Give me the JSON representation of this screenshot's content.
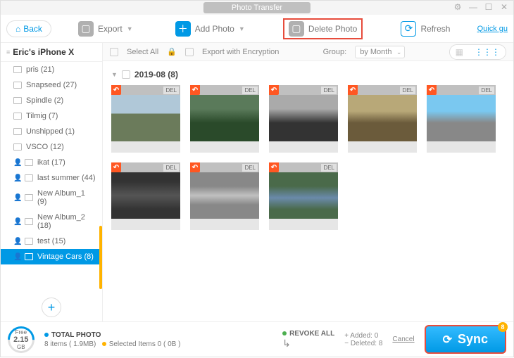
{
  "titlebar": {
    "title": "Photo Transfer"
  },
  "toolbar": {
    "back": "Back",
    "export": "Export",
    "add": "Add Photo",
    "delete": "Delete Photo",
    "refresh": "Refresh",
    "quick": "Quick gu"
  },
  "subbar": {
    "selectAll": "Select All",
    "encrypt": "Export with Encryption",
    "groupLabel": "Group:",
    "groupValue": "by Month"
  },
  "sidebar": {
    "device": "Eric's iPhone X",
    "items": [
      {
        "label": "pris (21)"
      },
      {
        "label": "Snapseed (27)"
      },
      {
        "label": "Spindle (2)"
      },
      {
        "label": "Tilmig (7)"
      },
      {
        "label": "Unshipped (1)"
      },
      {
        "label": "VSCO (12)"
      },
      {
        "label": "ikat (17)",
        "person": true
      },
      {
        "label": "last summer (44)",
        "person": true
      },
      {
        "label": "New Album_1 (9)",
        "person": true
      },
      {
        "label": "New Album_2 (18)",
        "person": true
      },
      {
        "label": "test (15)",
        "person": true
      },
      {
        "label": "Vintage Cars (8)",
        "person": true,
        "active": true
      }
    ]
  },
  "content": {
    "groupTitle": "2019-08 (8)",
    "delLabel": "DEL"
  },
  "footer": {
    "free": "Free",
    "gaugeVal": "2.15",
    "gaugeUnit": "GB",
    "totalLabel": "TOTAL PHOTO",
    "totalText": "8 items ( 1.9MB)",
    "selectedText": "Selected Items 0 ( 0B )",
    "revokeAll": "REVOKE ALL",
    "revokeArrow": "↳",
    "added": "+   Added: 0",
    "deleted": "−   Deleted: 8",
    "cancel": "Cancel",
    "sync": "Sync",
    "syncBadge": "8"
  }
}
